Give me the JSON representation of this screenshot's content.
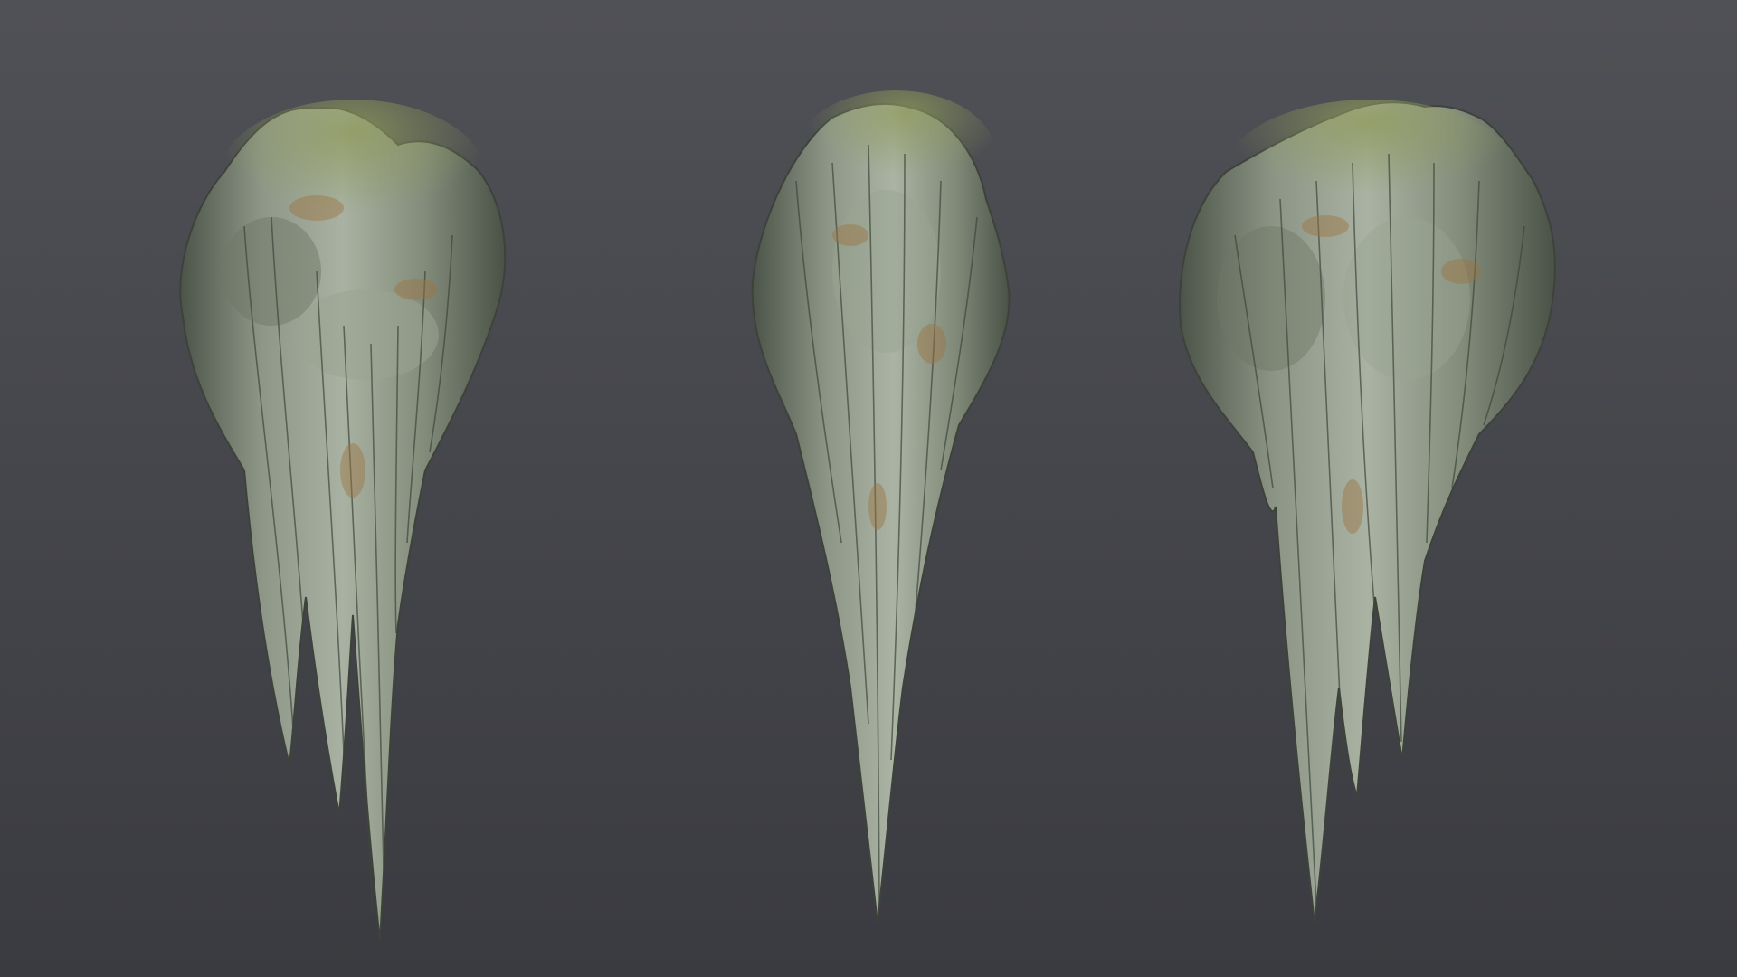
{
  "scene": {
    "background": {
      "top": "#505156",
      "middle": "#44454a",
      "bottom": "#3a3b40"
    },
    "object_count": 3,
    "objects": [
      {
        "name": "stalactite-rock-front-view",
        "description_icon": "stalactite-icon"
      },
      {
        "name": "stalactite-rock-side-view",
        "description_icon": "stalactite-icon"
      },
      {
        "name": "stalactite-rock-back-view",
        "description_icon": "stalactite-icon"
      }
    ],
    "palette": {
      "stone_light": "#aeb7a8",
      "stone_mid": "#7c8576",
      "stone_dark": "#4a5247",
      "moss": "#7f8a4c",
      "rust": "#9c7340",
      "shadow": "#2f3430"
    }
  }
}
